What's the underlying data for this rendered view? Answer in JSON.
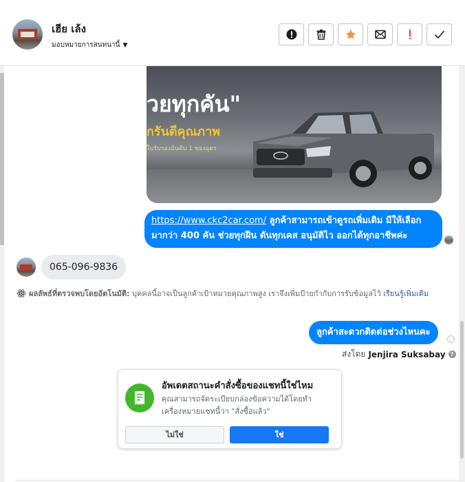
{
  "header": {
    "name": "เฮีย เล้ง",
    "assign_label": "มอบหมายการสนทนานี้",
    "tools": [
      {
        "icon": "alert-circle-icon",
        "name": "mark-spam-button"
      },
      {
        "icon": "trash-icon",
        "name": "delete-button"
      },
      {
        "icon": "star-icon",
        "name": "star-button",
        "color": "#f7923b"
      },
      {
        "icon": "mail-icon",
        "name": "mark-unread-button"
      },
      {
        "icon": "exclamation-icon",
        "name": "follow-up-button",
        "color": "#fa383e"
      },
      {
        "icon": "check-icon",
        "name": "mark-done-button"
      }
    ]
  },
  "ad_image": {
    "slogan": "วยทุกคัน\"",
    "sub": "กรันตีคุณภาพ",
    "tiny": "ใบรับรองอันดับ 1 ของอุดร"
  },
  "messages": {
    "outgoing1": {
      "link": "https://www.ckc2car.com/",
      "text": " ลูกค้าสามารถเข้าดูรถเพิ่มเติม มีให้เลือกมากว่า 400 คัน ช่วยทุกฝืน ดันทุกเคส อนุมัติไว ออกได้ทุกอาชีพค่ะ"
    },
    "incoming1": "065-096-9836",
    "notice": {
      "label": "ผลลัพธ์ที่ตรวจพบโดยอัตโนมัติ:",
      "text": " บุคคลนี้อาจเป็นลูกค้าเป้าหมายคุณภาพสูง เราจึงเพิ่มป้ายกำกับการรับข้อมูลไว้ ",
      "learn_more": "เรียนรู้เพิ่มเติม"
    },
    "outgoing2": "ลูกค้าสะดวกติดต่อช่วงไหนคะ",
    "sent_by_label": "ส่งโดย",
    "sent_by_name": "Jenjira Suksabay"
  },
  "card": {
    "title": "อัพเดตสถานะคำสั่งซื้อของแชทนี้ใช่ไหม",
    "description": "คุณสามารถจัดระเบียบกล่องข้อความได้โดยทำเครื่องหมายแชทนี้ว่า \"สั่งซื้อแล้ว\"",
    "no_label": "ไม่ใช่",
    "yes_label": "ใช่"
  },
  "colors": {
    "accent": "#0084ff",
    "button_primary": "#1877f2",
    "card_icon": "#42b72a"
  }
}
